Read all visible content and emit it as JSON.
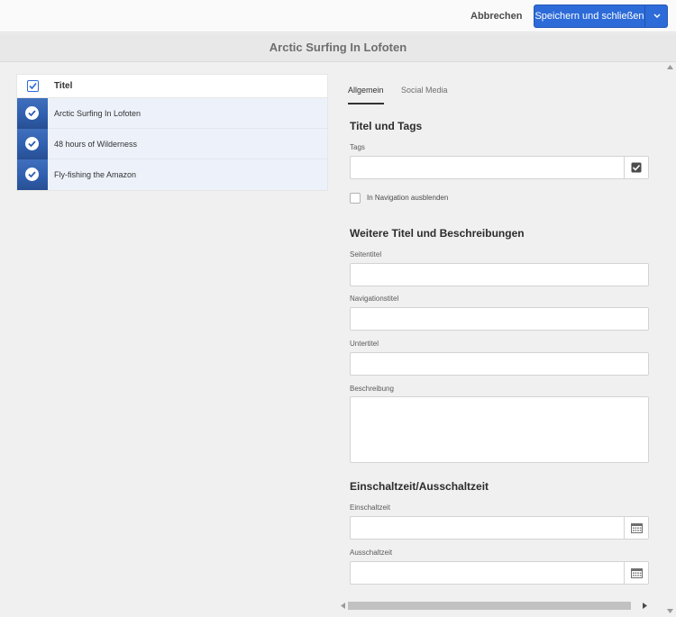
{
  "toolbar": {
    "cancel_label": "Abbrechen",
    "save_label": "Speichern und schließen"
  },
  "page": {
    "title": "Arctic Surfing In Lofoten"
  },
  "list": {
    "column_header": "Titel",
    "items": [
      {
        "label": "Arctic Surfing In Lofoten",
        "selected": true
      },
      {
        "label": "48 hours of Wilderness",
        "selected": true
      },
      {
        "label": "Fly-fishing the Amazon",
        "selected": true
      }
    ]
  },
  "tabs": [
    {
      "label": "Allgemein",
      "active": true
    },
    {
      "label": "Social Media",
      "active": false
    }
  ],
  "form": {
    "section1_title": "Titel und Tags",
    "tags_label": "Tags",
    "tags_value": "",
    "hide_nav_label": "In Navigation ausblenden",
    "section2_title": "Weitere Titel und Beschreibungen",
    "page_title_label": "Seitentitel",
    "nav_title_label": "Navigationstitel",
    "subtitle_label": "Untertitel",
    "description_label": "Beschreibung",
    "section3_title": "Einschaltzeit/Ausschaltzeit",
    "on_time_label": "Einschaltzeit",
    "off_time_label": "Ausschaltzeit"
  },
  "colors": {
    "accent": "#2d6bd8",
    "selected_row": "#edf2fa"
  }
}
